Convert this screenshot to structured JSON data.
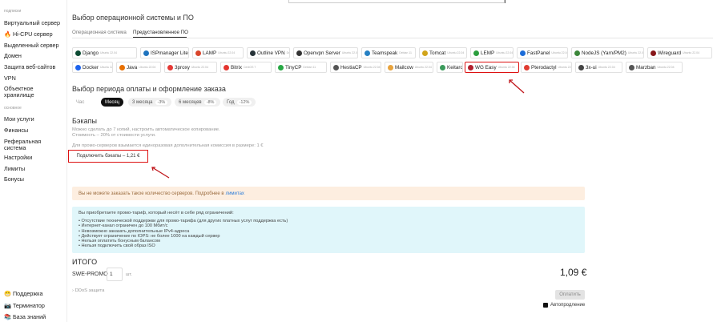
{
  "sidebar": {
    "section1": "подписки",
    "items1": [
      {
        "label": "Виртуальный сервер",
        "icon": ""
      },
      {
        "label": "🔥 Hi-CPU сервер",
        "icon": "fire-icon"
      },
      {
        "label": "Выделенный сервер",
        "icon": ""
      },
      {
        "label": "Домен",
        "icon": ""
      },
      {
        "label": "Защита веб-сайтов",
        "icon": ""
      },
      {
        "label": "VPN",
        "icon": ""
      },
      {
        "label": "Объектное хранилище",
        "icon": ""
      }
    ],
    "section2": "основное",
    "items2": [
      {
        "label": "Мои услуги"
      },
      {
        "label": "Финансы"
      },
      {
        "label": "Реферальная система"
      },
      {
        "label": "Настройки"
      },
      {
        "label": "Лимиты"
      },
      {
        "label": "Бонусы"
      }
    ],
    "bottom": [
      {
        "label": "😁 Поддержка",
        "icon": "smile-icon"
      },
      {
        "label": "📷 Терминатор",
        "icon": "camera-icon"
      },
      {
        "label": "📚 База знаний",
        "icon": "books-icon"
      }
    ]
  },
  "os": {
    "title": "Выбор операционной системы и ПО",
    "tabs": [
      "Операционная система",
      "Предустановленное ПО"
    ],
    "active_tab": 1,
    "row1": [
      {
        "name": "Django",
        "sub": "Ubuntu 22.04",
        "color": "#0c4b33"
      },
      {
        "name": "ISPmanager Lite",
        "sub": "Ubuntu 22.04",
        "color": "#1e73be"
      },
      {
        "name": "LAMP",
        "sub": "Ubuntu 22.04",
        "color": "#d9452b"
      },
      {
        "name": "Outline VPN",
        "sub": "Debian 11",
        "color": "#263238"
      },
      {
        "name": "Openvpn Server",
        "sub": "Ubuntu 22.04",
        "color": "#333"
      },
      {
        "name": "Teamspeak",
        "sub": "Debian 11",
        "color": "#2580c3"
      },
      {
        "name": "Tomcat",
        "sub": "Ubuntu 22.04",
        "color": "#d1a41a"
      },
      {
        "name": "LEMP",
        "sub": "Ubuntu 22.04",
        "color": "#2b9e3e"
      },
      {
        "name": "FastPanel",
        "sub": "Ubuntu 22.04",
        "color": "#1c6cd8"
      },
      {
        "name": "NodeJS (Yarn/PM2)",
        "sub": "Ubuntu 22.04",
        "color": "#3c873a"
      },
      {
        "name": "Wireguard",
        "sub": "Ubuntu 22.04",
        "color": "#88171a"
      }
    ],
    "row2": [
      {
        "name": "Docker",
        "sub": "Ubuntu 22.04",
        "color": "#1d63ed"
      },
      {
        "name": "Java",
        "sub": "Ubuntu 22.04",
        "color": "#e76f00"
      },
      {
        "name": "3proxy",
        "sub": "Ubuntu 22.04",
        "color": "#e53935"
      },
      {
        "name": "Bitrix",
        "sub": "CentOS 7",
        "color": "#e4352f"
      },
      {
        "name": "TinyCP",
        "sub": "Debian 11",
        "color": "#27a844"
      },
      {
        "name": "HestiaCP",
        "sub": "Ubuntu 22.04",
        "color": "#555"
      },
      {
        "name": "Mailcow",
        "sub": "Ubuntu 22.04",
        "color": "#e8a33d"
      },
      {
        "name": "Keitaro.io",
        "sub": "CentOS 8 Stream",
        "color": "#3b9a5b"
      },
      {
        "name": "WG Easy",
        "sub": "Ubuntu 22.04",
        "color": "#b21f2d"
      },
      {
        "name": "Pterodactyl",
        "sub": "Ubuntu 22.04",
        "color": "#e03c31"
      },
      {
        "name": "3x-ui",
        "sub": "Ubuntu 22.04",
        "color": "#444"
      },
      {
        "name": "Marzban",
        "sub": "Ubuntu 22.04",
        "color": "#555"
      }
    ],
    "selected": "WG Easy"
  },
  "period": {
    "title": "Выбор периода оплаты и оформление заказа",
    "options": [
      {
        "label": "Час",
        "badge": ""
      },
      {
        "label": "Месяц",
        "badge": ""
      },
      {
        "label": "3 месяца",
        "badge": "-3%"
      },
      {
        "label": "6 месяцев",
        "badge": "-8%"
      },
      {
        "label": "Год",
        "badge": "-12%"
      }
    ],
    "active": "Месяц"
  },
  "backups": {
    "title": "Бэкапы",
    "line1": "Можно сделать до 7 копий, настроить автоматическое копирование.",
    "line2": "Стоимость – 20% от стоимости услуги.",
    "promo_note": "Для промо-серверов взымается единоразовая дополнительная комиссия в размере: 1 €",
    "button": "Подключить бэкапы – 1,21 €"
  },
  "warning": {
    "text": "Вы не можете заказать такое количество серверов. Подробнее в",
    "link": "лимитах"
  },
  "info": {
    "intro": "Вы приобретаете промо-тариф, который несёт в себе ряд ограничений:",
    "items": [
      "Отсутствие технической поддержки для промо-тарифа (для других платных услуг поддержка есть)",
      "Интернет-канал ограничен до 100 Мбит/с",
      "Невозможно заказать дополнительные IPv4-адреса",
      "Действует ограничение по IOPS: не более 1000 на каждый сервер",
      "Нельзя оплатить бонусным балансом",
      "Нельзя подключить свой образ ISO"
    ]
  },
  "total": {
    "title": "ИТОГО",
    "product": "SWE-PROMO",
    "qty": "1",
    "unit": "шт.",
    "price": "1,09 €",
    "ddos": "DDoS защита",
    "pay": "Оплатить",
    "autorenew": "Автопродление"
  }
}
